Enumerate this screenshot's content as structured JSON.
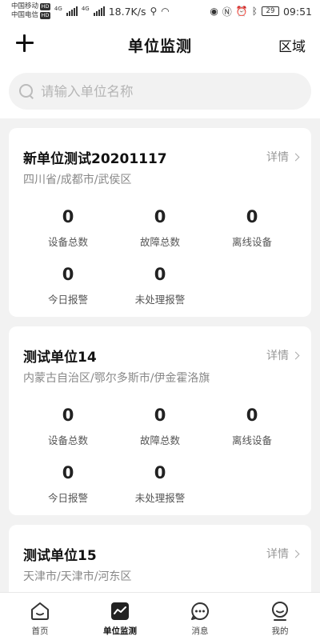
{
  "status_bar": {
    "carrier1": "中国移动",
    "carrier2": "中国电信",
    "hd": "HD",
    "net1": "4G",
    "net2": "4G",
    "speed": "18.7K/s",
    "battery": "29",
    "time": "09:51"
  },
  "header": {
    "title": "单位监测",
    "region_label": "区域"
  },
  "search": {
    "placeholder": "请输入单位名称"
  },
  "units": [
    {
      "name": "新单位测试20201117",
      "detail": "详情",
      "region": "四川省/成都市/武侯区",
      "stats": [
        {
          "value": "0",
          "label": "设备总数"
        },
        {
          "value": "0",
          "label": "故障总数"
        },
        {
          "value": "0",
          "label": "离线设备"
        },
        {
          "value": "0",
          "label": "今日报警"
        },
        {
          "value": "0",
          "label": "未处理报警"
        }
      ]
    },
    {
      "name": "测试单位14",
      "detail": "详情",
      "region": "内蒙古自治区/鄂尔多斯市/伊金霍洛旗",
      "stats": [
        {
          "value": "0",
          "label": "设备总数"
        },
        {
          "value": "0",
          "label": "故障总数"
        },
        {
          "value": "0",
          "label": "离线设备"
        },
        {
          "value": "0",
          "label": "今日报警"
        },
        {
          "value": "0",
          "label": "未处理报警"
        }
      ]
    },
    {
      "name": "测试单位15",
      "detail": "详情",
      "region": "天津市/天津市/河东区"
    }
  ],
  "bottom_nav": [
    {
      "label": "首页",
      "icon": "home-icon"
    },
    {
      "label": "单位监测",
      "icon": "monitor-icon"
    },
    {
      "label": "消息",
      "icon": "message-icon"
    },
    {
      "label": "我的",
      "icon": "profile-icon"
    }
  ]
}
